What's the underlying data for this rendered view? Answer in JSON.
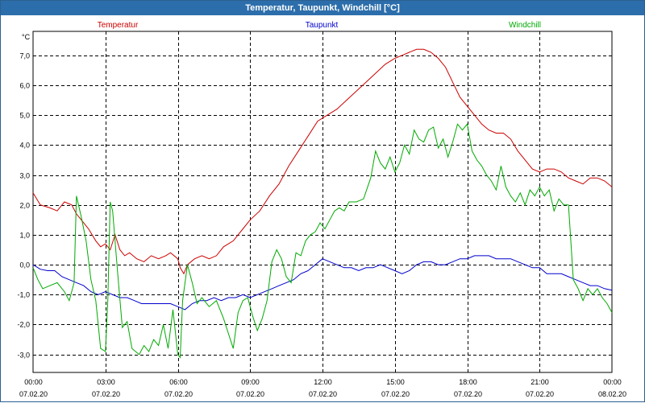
{
  "window": {
    "title": "Temperatur, Taupunkt, Windchill [°C]"
  },
  "chart_data": {
    "type": "line",
    "unit_label": "°C",
    "ylim": [
      -3.6,
      7.8
    ],
    "xlim": [
      0,
      24
    ],
    "grid": true,
    "y_ticks": [
      {
        "value": 7,
        "label": "7,0"
      },
      {
        "value": 6,
        "label": "6,0"
      },
      {
        "value": 5,
        "label": "5,0"
      },
      {
        "value": 4,
        "label": "4,0"
      },
      {
        "value": 3,
        "label": "3,0"
      },
      {
        "value": 2,
        "label": "2,0"
      },
      {
        "value": 1,
        "label": "1,0"
      },
      {
        "value": 0,
        "label": "0,0"
      },
      {
        "value": -1,
        "label": "-1,0"
      },
      {
        "value": -2,
        "label": "-2,0"
      },
      {
        "value": -3,
        "label": "-3,0"
      }
    ],
    "x_ticks": [
      {
        "hour": 0,
        "time": "00:00",
        "date": "07.02.20"
      },
      {
        "hour": 3,
        "time": "03:00",
        "date": "07.02.20"
      },
      {
        "hour": 6,
        "time": "06:00",
        "date": "07.02.20"
      },
      {
        "hour": 9,
        "time": "09:00",
        "date": "07.02.20"
      },
      {
        "hour": 12,
        "time": "12:00",
        "date": "07.02.20"
      },
      {
        "hour": 15,
        "time": "15:00",
        "date": "07.02.20"
      },
      {
        "hour": 18,
        "time": "18:00",
        "date": "07.02.20"
      },
      {
        "hour": 21,
        "time": "21:00",
        "date": "07.02.20"
      },
      {
        "hour": 24,
        "time": "00:00",
        "date": "08.02.20"
      }
    ],
    "series": [
      {
        "name": "Temperatur",
        "color": "#cc0000",
        "legend_position": "left",
        "points": [
          [
            0,
            2.4
          ],
          [
            0.3,
            2.0
          ],
          [
            0.7,
            1.9
          ],
          [
            1.0,
            1.8
          ],
          [
            1.3,
            2.1
          ],
          [
            1.6,
            2.0
          ],
          [
            1.8,
            1.7
          ],
          [
            2.0,
            1.5
          ],
          [
            2.3,
            1.2
          ],
          [
            2.6,
            0.8
          ],
          [
            2.8,
            0.6
          ],
          [
            3.0,
            0.7
          ],
          [
            3.2,
            0.5
          ],
          [
            3.4,
            1.0
          ],
          [
            3.6,
            0.5
          ],
          [
            3.8,
            0.3
          ],
          [
            4.0,
            0.4
          ],
          [
            4.3,
            0.2
          ],
          [
            4.6,
            0.1
          ],
          [
            4.9,
            0.3
          ],
          [
            5.2,
            0.2
          ],
          [
            5.5,
            0.3
          ],
          [
            5.7,
            0.4
          ],
          [
            6.0,
            0.2
          ],
          [
            6.1,
            -0.1
          ],
          [
            6.25,
            -0.3
          ],
          [
            6.4,
            0.0
          ],
          [
            6.7,
            0.2
          ],
          [
            7.0,
            0.3
          ],
          [
            7.3,
            0.2
          ],
          [
            7.6,
            0.3
          ],
          [
            7.9,
            0.6
          ],
          [
            8.3,
            0.8
          ],
          [
            8.7,
            1.2
          ],
          [
            9.0,
            1.5
          ],
          [
            9.4,
            1.8
          ],
          [
            9.8,
            2.3
          ],
          [
            10.2,
            2.7
          ],
          [
            10.6,
            3.3
          ],
          [
            11.0,
            3.8
          ],
          [
            11.4,
            4.3
          ],
          [
            11.8,
            4.8
          ],
          [
            12.2,
            5.0
          ],
          [
            12.6,
            5.2
          ],
          [
            13.0,
            5.5
          ],
          [
            13.4,
            5.8
          ],
          [
            13.8,
            6.1
          ],
          [
            14.2,
            6.4
          ],
          [
            14.6,
            6.7
          ],
          [
            15.0,
            6.9
          ],
          [
            15.3,
            7.0
          ],
          [
            15.6,
            7.1
          ],
          [
            15.9,
            7.2
          ],
          [
            16.2,
            7.2
          ],
          [
            16.5,
            7.1
          ],
          [
            16.8,
            6.9
          ],
          [
            17.1,
            6.6
          ],
          [
            17.4,
            6.1
          ],
          [
            17.7,
            5.6
          ],
          [
            18.0,
            5.3
          ],
          [
            18.3,
            5.0
          ],
          [
            18.6,
            4.7
          ],
          [
            18.9,
            4.5
          ],
          [
            19.2,
            4.4
          ],
          [
            19.5,
            4.4
          ],
          [
            19.8,
            4.2
          ],
          [
            20.1,
            3.8
          ],
          [
            20.4,
            3.5
          ],
          [
            20.7,
            3.2
          ],
          [
            21.0,
            3.1
          ],
          [
            21.3,
            3.2
          ],
          [
            21.6,
            3.2
          ],
          [
            21.9,
            3.1
          ],
          [
            22.2,
            2.9
          ],
          [
            22.5,
            2.8
          ],
          [
            22.8,
            2.7
          ],
          [
            23.1,
            2.9
          ],
          [
            23.4,
            2.9
          ],
          [
            23.7,
            2.8
          ],
          [
            24.0,
            2.6
          ]
        ]
      },
      {
        "name": "Taupunkt",
        "color": "#0000cc",
        "legend_position": "center",
        "points": [
          [
            0,
            0.0
          ],
          [
            0.3,
            -0.15
          ],
          [
            0.6,
            -0.2
          ],
          [
            0.9,
            -0.2
          ],
          [
            1.2,
            -0.4
          ],
          [
            1.5,
            -0.5
          ],
          [
            1.8,
            -0.6
          ],
          [
            2.1,
            -0.7
          ],
          [
            2.4,
            -0.9
          ],
          [
            2.7,
            -1.0
          ],
          [
            3.0,
            -0.9
          ],
          [
            3.3,
            -1.0
          ],
          [
            3.6,
            -1.1
          ],
          [
            3.9,
            -1.1
          ],
          [
            4.2,
            -1.2
          ],
          [
            4.5,
            -1.3
          ],
          [
            4.8,
            -1.3
          ],
          [
            5.1,
            -1.3
          ],
          [
            5.4,
            -1.3
          ],
          [
            5.7,
            -1.3
          ],
          [
            6.0,
            -1.4
          ],
          [
            6.3,
            -1.5
          ],
          [
            6.6,
            -1.3
          ],
          [
            6.9,
            -1.2
          ],
          [
            7.2,
            -1.2
          ],
          [
            7.5,
            -1.1
          ],
          [
            7.8,
            -1.2
          ],
          [
            8.1,
            -1.1
          ],
          [
            8.4,
            -1.1
          ],
          [
            8.7,
            -1.0
          ],
          [
            9.0,
            -1.1
          ],
          [
            9.3,
            -1.0
          ],
          [
            9.6,
            -0.9
          ],
          [
            9.9,
            -0.8
          ],
          [
            10.2,
            -0.7
          ],
          [
            10.5,
            -0.6
          ],
          [
            10.8,
            -0.5
          ],
          [
            11.1,
            -0.3
          ],
          [
            11.4,
            -0.2
          ],
          [
            11.7,
            0.0
          ],
          [
            12.0,
            0.2
          ],
          [
            12.3,
            0.1
          ],
          [
            12.6,
            0.0
          ],
          [
            12.9,
            -0.1
          ],
          [
            13.2,
            -0.1
          ],
          [
            13.5,
            -0.2
          ],
          [
            13.8,
            -0.1
          ],
          [
            14.1,
            -0.1
          ],
          [
            14.4,
            0.0
          ],
          [
            14.7,
            -0.1
          ],
          [
            15.0,
            -0.2
          ],
          [
            15.3,
            -0.3
          ],
          [
            15.6,
            -0.2
          ],
          [
            15.9,
            0.0
          ],
          [
            16.2,
            0.1
          ],
          [
            16.5,
            0.1
          ],
          [
            16.8,
            0.0
          ],
          [
            17.1,
            0.0
          ],
          [
            17.4,
            0.1
          ],
          [
            17.7,
            0.2
          ],
          [
            18.0,
            0.2
          ],
          [
            18.3,
            0.3
          ],
          [
            18.6,
            0.3
          ],
          [
            18.9,
            0.3
          ],
          [
            19.2,
            0.2
          ],
          [
            19.5,
            0.2
          ],
          [
            19.8,
            0.2
          ],
          [
            20.1,
            0.1
          ],
          [
            20.4,
            0.0
          ],
          [
            20.7,
            -0.1
          ],
          [
            21.0,
            -0.1
          ],
          [
            21.3,
            -0.3
          ],
          [
            21.6,
            -0.3
          ],
          [
            21.9,
            -0.3
          ],
          [
            22.2,
            -0.4
          ],
          [
            22.5,
            -0.5
          ],
          [
            22.8,
            -0.6
          ],
          [
            23.1,
            -0.7
          ],
          [
            23.4,
            -0.7
          ],
          [
            23.7,
            -0.8
          ],
          [
            24.0,
            -0.85
          ]
        ]
      },
      {
        "name": "Windchill",
        "color": "#00aa00",
        "legend_position": "right",
        "points": [
          [
            0,
            -0.1
          ],
          [
            0.2,
            -0.5
          ],
          [
            0.4,
            -0.8
          ],
          [
            0.7,
            -0.7
          ],
          [
            1.0,
            -0.6
          ],
          [
            1.3,
            -0.9
          ],
          [
            1.5,
            -1.2
          ],
          [
            1.7,
            -0.6
          ],
          [
            1.8,
            2.3
          ],
          [
            2.0,
            1.6
          ],
          [
            2.2,
            0.8
          ],
          [
            2.4,
            -0.5
          ],
          [
            2.6,
            -1.2
          ],
          [
            2.8,
            -2.8
          ],
          [
            3.0,
            -2.9
          ],
          [
            3.1,
            -1.2
          ],
          [
            3.2,
            2.1
          ],
          [
            3.3,
            1.8
          ],
          [
            3.5,
            -0.2
          ],
          [
            3.7,
            -2.1
          ],
          [
            3.9,
            -1.9
          ],
          [
            4.1,
            -2.8
          ],
          [
            4.4,
            -3.0
          ],
          [
            4.6,
            -2.7
          ],
          [
            4.8,
            -2.9
          ],
          [
            5.0,
            -2.5
          ],
          [
            5.2,
            -2.7
          ],
          [
            5.4,
            -2.0
          ],
          [
            5.6,
            -2.8
          ],
          [
            5.8,
            -1.5
          ],
          [
            6.0,
            -3.0
          ],
          [
            6.1,
            -3.1
          ],
          [
            6.2,
            -1.2
          ],
          [
            6.4,
            0.0
          ],
          [
            6.6,
            -0.6
          ],
          [
            6.8,
            -1.3
          ],
          [
            7.0,
            -1.1
          ],
          [
            7.3,
            -1.4
          ],
          [
            7.6,
            -1.2
          ],
          [
            7.9,
            -1.8
          ],
          [
            8.1,
            -2.3
          ],
          [
            8.3,
            -2.8
          ],
          [
            8.5,
            -1.6
          ],
          [
            8.7,
            -1.2
          ],
          [
            8.9,
            -1.1
          ],
          [
            9.1,
            -1.7
          ],
          [
            9.3,
            -2.2
          ],
          [
            9.5,
            -1.8
          ],
          [
            9.7,
            -1.2
          ],
          [
            9.9,
            0.1
          ],
          [
            10.1,
            0.5
          ],
          [
            10.3,
            0.2
          ],
          [
            10.5,
            -0.4
          ],
          [
            10.7,
            -0.6
          ],
          [
            10.9,
            0.4
          ],
          [
            11.1,
            0.3
          ],
          [
            11.3,
            0.8
          ],
          [
            11.5,
            1.0
          ],
          [
            11.7,
            1.1
          ],
          [
            11.9,
            1.4
          ],
          [
            12.1,
            1.2
          ],
          [
            12.3,
            1.5
          ],
          [
            12.5,
            1.8
          ],
          [
            12.7,
            1.9
          ],
          [
            12.9,
            1.8
          ],
          [
            13.1,
            2.1
          ],
          [
            13.4,
            2.1
          ],
          [
            13.7,
            2.2
          ],
          [
            14.0,
            2.9
          ],
          [
            14.2,
            3.8
          ],
          [
            14.4,
            3.4
          ],
          [
            14.6,
            3.2
          ],
          [
            14.8,
            3.6
          ],
          [
            15.0,
            3.1
          ],
          [
            15.2,
            3.4
          ],
          [
            15.4,
            4.0
          ],
          [
            15.6,
            3.7
          ],
          [
            15.8,
            4.5
          ],
          [
            16.0,
            4.2
          ],
          [
            16.2,
            4.1
          ],
          [
            16.4,
            4.5
          ],
          [
            16.6,
            4.6
          ],
          [
            16.8,
            3.9
          ],
          [
            17.0,
            4.2
          ],
          [
            17.2,
            3.6
          ],
          [
            17.4,
            4.1
          ],
          [
            17.6,
            4.7
          ],
          [
            17.8,
            4.5
          ],
          [
            18.0,
            4.7
          ],
          [
            18.2,
            3.8
          ],
          [
            18.4,
            3.5
          ],
          [
            18.6,
            3.3
          ],
          [
            18.8,
            3.0
          ],
          [
            19.0,
            2.8
          ],
          [
            19.2,
            2.5
          ],
          [
            19.4,
            3.3
          ],
          [
            19.6,
            2.6
          ],
          [
            19.8,
            2.3
          ],
          [
            20.0,
            2.1
          ],
          [
            20.2,
            2.4
          ],
          [
            20.4,
            2.0
          ],
          [
            20.6,
            2.5
          ],
          [
            20.8,
            2.3
          ],
          [
            21.0,
            2.6
          ],
          [
            21.2,
            2.3
          ],
          [
            21.4,
            2.5
          ],
          [
            21.6,
            1.8
          ],
          [
            21.8,
            2.2
          ],
          [
            22.0,
            2.0
          ],
          [
            22.2,
            2.0
          ],
          [
            22.4,
            -0.5
          ],
          [
            22.6,
            -0.8
          ],
          [
            22.8,
            -1.2
          ],
          [
            23.0,
            -0.8
          ],
          [
            23.2,
            -1.0
          ],
          [
            23.4,
            -0.8
          ],
          [
            23.6,
            -1.1
          ],
          [
            23.8,
            -1.3
          ],
          [
            24.0,
            -1.6
          ]
        ]
      }
    ]
  }
}
